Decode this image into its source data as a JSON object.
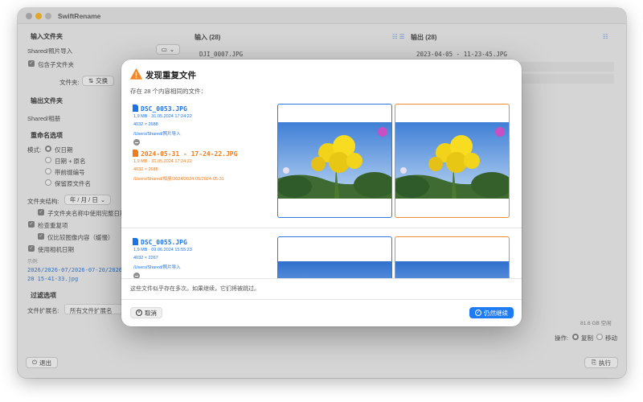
{
  "app": {
    "title": "SwiftRename"
  },
  "left": {
    "input_folder_title": "输入文件夹",
    "input_path": "Shared/照片导入",
    "include_subfolders": "包含子文件夹",
    "sort_label": "文件夹:",
    "sort_button": "交换",
    "output_folder_title": "输出文件夹",
    "output_path": "Shared/相册",
    "rename_options_title": "重命名选项",
    "mode_label": "模式:",
    "mode_options": [
      "仅日期",
      "日期 + 原名",
      "带前缀编号",
      "保留原文件名"
    ],
    "folder_structure_label": "文件夹结构:",
    "folder_structure_value": "年 / 月 / 日",
    "sub_full_date": "子文件夹名称中使用完整日期",
    "check_duplicates": "检查重复项",
    "compare_content": "仅比较图像内容（缓慢）",
    "use_camera_date": "使用相机日期",
    "example_label": "示例:",
    "example_value": "2026/2026-07/2026-07-20/2026-07-20 15-41-33.jpg",
    "filter_title": "过滤选项",
    "extension_label": "文件扩展名:",
    "extension_value": "所有文件扩展名"
  },
  "columns": {
    "input_title": "输入 (28)",
    "input_first": "DJI_0007.JPG",
    "output_title": "输出 (28)",
    "output_first": "2023-04-05 - 11-23-45.JPG"
  },
  "footer": {
    "disk_space": "81.6 GB 空闲",
    "operation_label": "操作:",
    "copy": "复制",
    "move": "移动",
    "quit": "退出",
    "run": "执行"
  },
  "dialog": {
    "title": "发现重复文件",
    "subtitle": "存在 28 个内容相同的文件：",
    "groups": [
      {
        "original": {
          "name": "DSC_0053.JPG",
          "size_date": "1,9 MB  ·  31.05.2024 17:24:22",
          "dimensions": "4032 × 2688",
          "path": "/Users/Shared/照片导入"
        },
        "duplicate": {
          "name": "2024-05-31 - 17-24-22.JPG",
          "size_date": "1,9 MB  ·  31.05.2024 17:24:22",
          "dimensions": "4032 × 2688",
          "path": "/Users/Shared/相册/2024/2024-05/2024-05-31"
        }
      },
      {
        "original": {
          "name": "DSC_0055.JPG",
          "size_date": "1,9 MB  ·  09.06.2024 15:55:23",
          "dimensions": "4032 × 2267",
          "path": "/Users/Shared/照片导入"
        }
      }
    ],
    "note": "这些文件似乎存在多次。如果继续，它们将被跳过。",
    "cancel": "取消",
    "continue": "仍然继续"
  },
  "colors": {
    "accent_blue": "#1f7bf2",
    "duplicate_orange": "#ef7b1a",
    "warning": "#f0882b"
  }
}
